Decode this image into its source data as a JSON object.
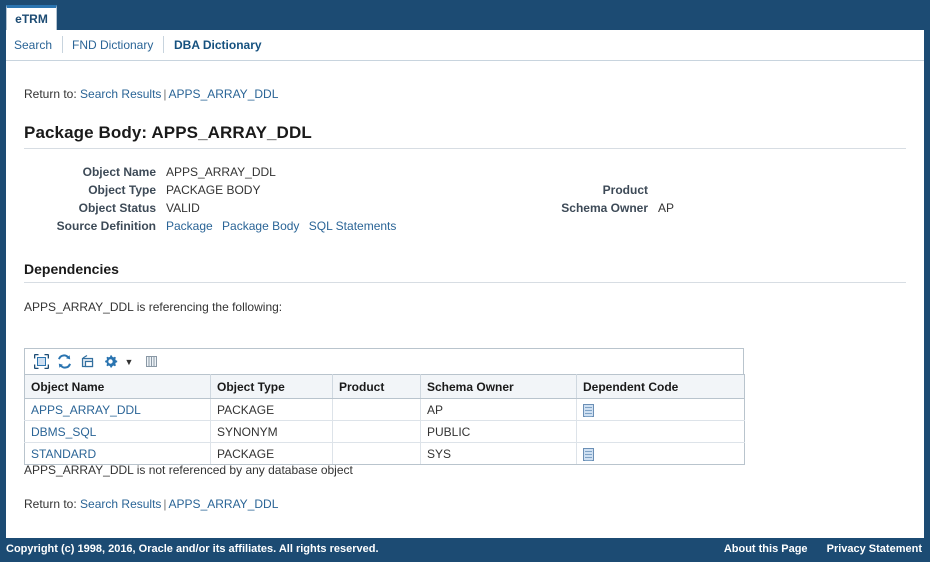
{
  "window": {
    "tab_label": "eTRM",
    "frame_color": "#1c4b73",
    "accent_color": "#2a74b0",
    "link_color": "#2a6496"
  },
  "subtabs": [
    {
      "label": "Search",
      "selected": false
    },
    {
      "label": "FND Dictionary",
      "selected": false
    },
    {
      "label": "DBA Dictionary",
      "selected": true
    }
  ],
  "return_to_top": {
    "label": "Return to:",
    "link1": "Search Results",
    "separator": "|",
    "link2": "APPS_ARRAY_DDL"
  },
  "page": {
    "title": "Package Body: APPS_ARRAY_DDL"
  },
  "properties": {
    "left": [
      {
        "label": "Object Name",
        "value": "APPS_ARRAY_DDL"
      },
      {
        "label": "Object Type",
        "value": "PACKAGE BODY"
      },
      {
        "label": "Object Status",
        "value": "VALID"
      }
    ],
    "source_definition": {
      "label": "Source Definition",
      "links": [
        "Package",
        "Package Body",
        "SQL Statements"
      ]
    },
    "right": [
      {
        "label": "Product",
        "value": ""
      },
      {
        "label": "Schema Owner",
        "value": "AP"
      }
    ]
  },
  "dependencies": {
    "heading": "Dependencies",
    "referencing_note": "APPS_ARRAY_DDL is referencing the following:",
    "toolbar": [
      {
        "name": "detach-icon",
        "title": "Detach"
      },
      {
        "name": "refresh-icon",
        "title": "Refresh"
      },
      {
        "name": "export-icon",
        "title": "Export"
      },
      {
        "name": "gear-icon",
        "title": "View"
      },
      {
        "name": "caret-down-icon",
        "title": "Menu"
      },
      {
        "name": "columns-icon",
        "title": "Columns"
      }
    ],
    "columns": [
      "Object Name",
      "Object Type",
      "Product",
      "Schema Owner",
      "Dependent Code"
    ],
    "rows": [
      {
        "object_name": "APPS_ARRAY_DDL",
        "object_type": "PACKAGE",
        "product": "",
        "schema_owner": "AP",
        "dependent_code": true
      },
      {
        "object_name": "DBMS_SQL",
        "object_type": "SYNONYM",
        "product": "",
        "schema_owner": "PUBLIC",
        "dependent_code": false
      },
      {
        "object_name": "STANDARD",
        "object_type": "PACKAGE",
        "product": "",
        "schema_owner": "SYS",
        "dependent_code": true
      }
    ],
    "referenced_note": "APPS_ARRAY_DDL is not referenced by any database object"
  },
  "return_to_bottom": {
    "label": "Return to:",
    "link1": "Search Results",
    "separator": "|",
    "link2": "APPS_ARRAY_DDL"
  },
  "footer": {
    "copyright": "Copyright (c) 1998, 2016, Oracle and/or its affiliates. All rights reserved.",
    "links": [
      "About this Page",
      "Privacy Statement"
    ]
  }
}
